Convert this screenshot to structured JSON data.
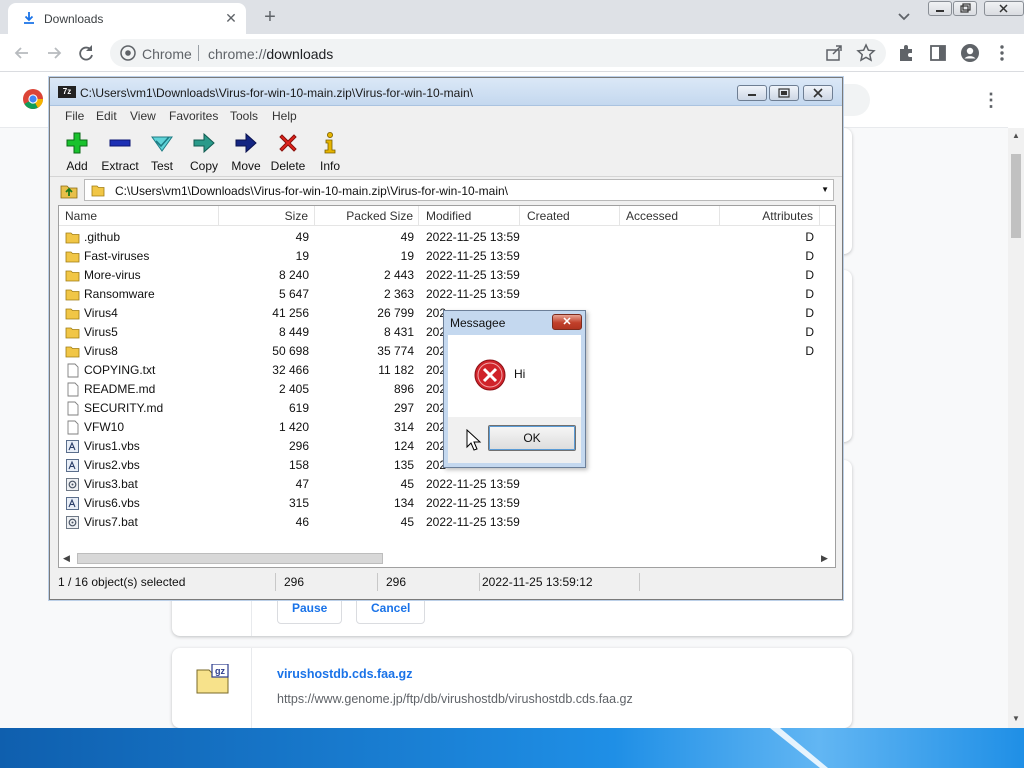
{
  "browser": {
    "tab_title": "Downloads",
    "new_tab_symbol": "+",
    "omnibox_site_label": "Chrome",
    "omnibox_url_scheme": "chrome://",
    "omnibox_url_host": "downloads"
  },
  "downloads_page": {
    "pause_label": "Pause",
    "cancel_label": "Cancel",
    "file_name": "virushostdb.cds.faa.gz",
    "file_url": "https://www.genome.jp/ftp/db/virushostdb/virushostdb.cds.faa.gz",
    "file_icon_text": "gz"
  },
  "sevenzip": {
    "app_icon_text": "7z",
    "title": "C:\\Users\\vm1\\Downloads\\Virus-for-win-10-main.zip\\Virus-for-win-10-main\\",
    "menu": [
      "File",
      "Edit",
      "View",
      "Favorites",
      "Tools",
      "Help"
    ],
    "tools": [
      "Add",
      "Extract",
      "Test",
      "Copy",
      "Move",
      "Delete",
      "Info"
    ],
    "address": "C:\\Users\\vm1\\Downloads\\Virus-for-win-10-main.zip\\Virus-for-win-10-main\\",
    "columns": [
      "Name",
      "Size",
      "Packed Size",
      "Modified",
      "Created",
      "Accessed",
      "Attributes"
    ],
    "rows": [
      {
        "name": ".github",
        "size": "49",
        "packed": "49",
        "modified": "2022-11-25 13:59",
        "attr": "D",
        "type": "folder"
      },
      {
        "name": "Fast-viruses",
        "size": "19",
        "packed": "19",
        "modified": "2022-11-25 13:59",
        "attr": "D",
        "type": "folder"
      },
      {
        "name": "More-virus",
        "size": "8 240",
        "packed": "2 443",
        "modified": "2022-11-25 13:59",
        "attr": "D",
        "type": "folder"
      },
      {
        "name": "Ransomware",
        "size": "5 647",
        "packed": "2 363",
        "modified": "2022-11-25 13:59",
        "attr": "D",
        "type": "folder"
      },
      {
        "name": "Virus4",
        "size": "41 256",
        "packed": "26 799",
        "modified": "202",
        "attr": "D",
        "type": "folder"
      },
      {
        "name": "Virus5",
        "size": "8 449",
        "packed": "8 431",
        "modified": "202",
        "attr": "D",
        "type": "folder"
      },
      {
        "name": "Virus8",
        "size": "50 698",
        "packed": "35 774",
        "modified": "202",
        "attr": "D",
        "type": "folder"
      },
      {
        "name": "COPYING.txt",
        "size": "32 466",
        "packed": "11 182",
        "modified": "202",
        "attr": "",
        "type": "file"
      },
      {
        "name": "README.md",
        "size": "2 405",
        "packed": "896",
        "modified": "202",
        "attr": "",
        "type": "file"
      },
      {
        "name": "SECURITY.md",
        "size": "619",
        "packed": "297",
        "modified": "202",
        "attr": "",
        "type": "file"
      },
      {
        "name": "VFW10",
        "size": "1 420",
        "packed": "314",
        "modified": "202",
        "attr": "",
        "type": "file"
      },
      {
        "name": "Virus1.vbs",
        "size": "296",
        "packed": "124",
        "modified": "202",
        "attr": "",
        "type": "script"
      },
      {
        "name": "Virus2.vbs",
        "size": "158",
        "packed": "135",
        "modified": "202",
        "attr": "",
        "type": "script"
      },
      {
        "name": "Virus3.bat",
        "size": "47",
        "packed": "45",
        "modified": "2022-11-25 13:59",
        "attr": "",
        "type": "batch"
      },
      {
        "name": "Virus6.vbs",
        "size": "315",
        "packed": "134",
        "modified": "2022-11-25 13:59",
        "attr": "",
        "type": "script"
      },
      {
        "name": "Virus7.bat",
        "size": "46",
        "packed": "45",
        "modified": "2022-11-25 13:59",
        "attr": "",
        "type": "batch"
      }
    ],
    "status": {
      "selection": "1 / 16 object(s) selected",
      "size": "296",
      "packed": "296",
      "modified": "2022-11-25 13:59:12"
    }
  },
  "dialog": {
    "title": "Messagee",
    "message": "Hi",
    "ok_label": "OK",
    "close_symbol": "✕"
  },
  "colors": {
    "accent_blue": "#1a73e8",
    "error_red": "#d0232a",
    "titlebar": "#c4d8ef"
  }
}
